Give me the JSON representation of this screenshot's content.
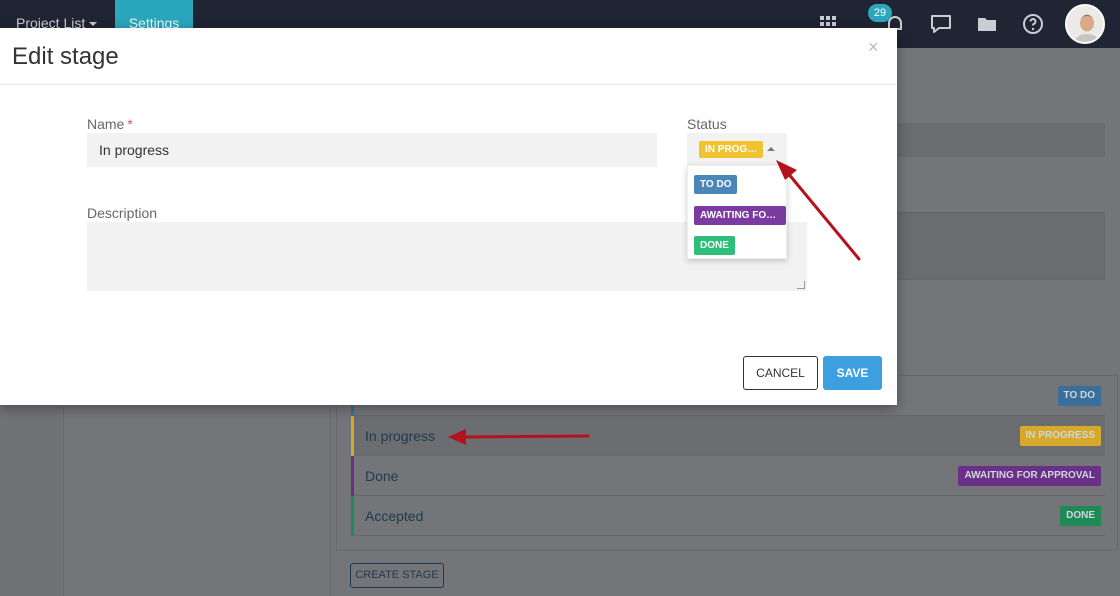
{
  "topbar": {
    "project_menu": "Project List",
    "settings_tab": "Settings",
    "notification_count": "29",
    "icons": [
      "apps-grid-icon",
      "bell-icon",
      "chat-icon",
      "folder-icon",
      "help-icon"
    ]
  },
  "background": {
    "stages": [
      {
        "name": "",
        "tag": "TO DO",
        "bar_color": "#3a6f9c",
        "tag_color": "#3a6f9c"
      },
      {
        "name": "In progress",
        "tag": "IN PROGRESS",
        "bar_color": "#d6a92a",
        "tag_color": "#d6a92a"
      },
      {
        "name": "Done",
        "tag": "AWAITING FOR APPROVAL",
        "bar_color": "#6a2f86",
        "tag_color": "#6a2f86"
      },
      {
        "name": "Accepted",
        "tag": "DONE",
        "bar_color": "#1e8a55",
        "tag_color": "#1e8a55"
      }
    ],
    "create_button": "CREATE STAGE"
  },
  "modal": {
    "title": "Edit stage",
    "close": "×",
    "name_label": "Name",
    "required_mark": "*",
    "name_value": "In progress",
    "description_label": "Description",
    "description_value": "",
    "status_label": "Status",
    "status_selected": "IN PROG…",
    "status_options": [
      {
        "label": "TO DO",
        "color": "#4a86b8"
      },
      {
        "label": "AWAITING FO…",
        "color": "#7b3aa0"
      },
      {
        "label": "DONE",
        "color": "#2dbe7a"
      }
    ],
    "cancel_label": "CANCEL",
    "save_label": "SAVE"
  },
  "colors": {
    "topbar": "#1f2533",
    "accent": "#2aa7bd",
    "save": "#3e9fe0",
    "status_in_progress": "#f0c331",
    "annotation_arrow": "#b5121b"
  }
}
